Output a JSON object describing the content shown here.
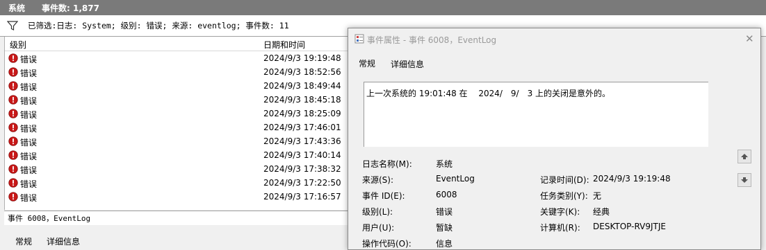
{
  "window": {
    "title": "系统",
    "event_count": "事件数: 1,877"
  },
  "filter": {
    "text": "已筛选:日志: System; 级别: 错误; 来源: eventlog; 事件数: 11"
  },
  "list": {
    "columns": {
      "level": "级别",
      "datetime": "日期和时间"
    },
    "rows": [
      {
        "level": "错误",
        "datetime": "2024/9/3 19:19:48"
      },
      {
        "level": "错误",
        "datetime": "2024/9/3 18:52:56"
      },
      {
        "level": "错误",
        "datetime": "2024/9/3 18:49:44"
      },
      {
        "level": "错误",
        "datetime": "2024/9/3 18:45:18"
      },
      {
        "level": "错误",
        "datetime": "2024/9/3 18:25:09"
      },
      {
        "level": "错误",
        "datetime": "2024/9/3 17:46:01"
      },
      {
        "level": "错误",
        "datetime": "2024/9/3 17:43:36"
      },
      {
        "level": "错误",
        "datetime": "2024/9/3 17:40:14"
      },
      {
        "level": "错误",
        "datetime": "2024/9/3 17:38:32"
      },
      {
        "level": "错误",
        "datetime": "2024/9/3 17:22:50"
      },
      {
        "level": "错误",
        "datetime": "2024/9/3 17:16:57"
      }
    ]
  },
  "detail_bar": {
    "text": "事件 6008，EventLog"
  },
  "bottom_tabs": {
    "general": "常规",
    "details": "详细信息"
  },
  "dialog": {
    "title": "事件属性 - 事件 6008，EventLog",
    "tabs": {
      "general": "常规",
      "details": "详细信息"
    },
    "message": "上一次系统的 19:01:48 在 　2024/　9/　3 上的关闭是意外的。",
    "props": {
      "log_name_label": "日志名称(M):",
      "log_name_value": "系统",
      "source_label": "来源(S):",
      "source_value": "EventLog",
      "logged_label": "记录时间(D):",
      "logged_value": "2024/9/3 19:19:48",
      "event_id_label": "事件 ID(E):",
      "event_id_value": "6008",
      "task_label": "任务类别(Y):",
      "task_value": "无",
      "level_label": "级别(L):",
      "level_value": "错误",
      "keywords_label": "关键字(K):",
      "keywords_value": "经典",
      "user_label": "用户(U):",
      "user_value": "暂缺",
      "computer_label": "计算机(R):",
      "computer_value": "DESKTOP-RV9JTJE",
      "opcode_label": "操作代码(O):",
      "opcode_value": "信息"
    }
  },
  "icons": {
    "error": "error-icon",
    "filter": "filter-icon",
    "up": "arrow-up-icon",
    "down": "arrow-down-icon",
    "close": "close-icon"
  },
  "colors": {
    "titlebar": "#7a7a7a",
    "error_red": "#c81818"
  }
}
